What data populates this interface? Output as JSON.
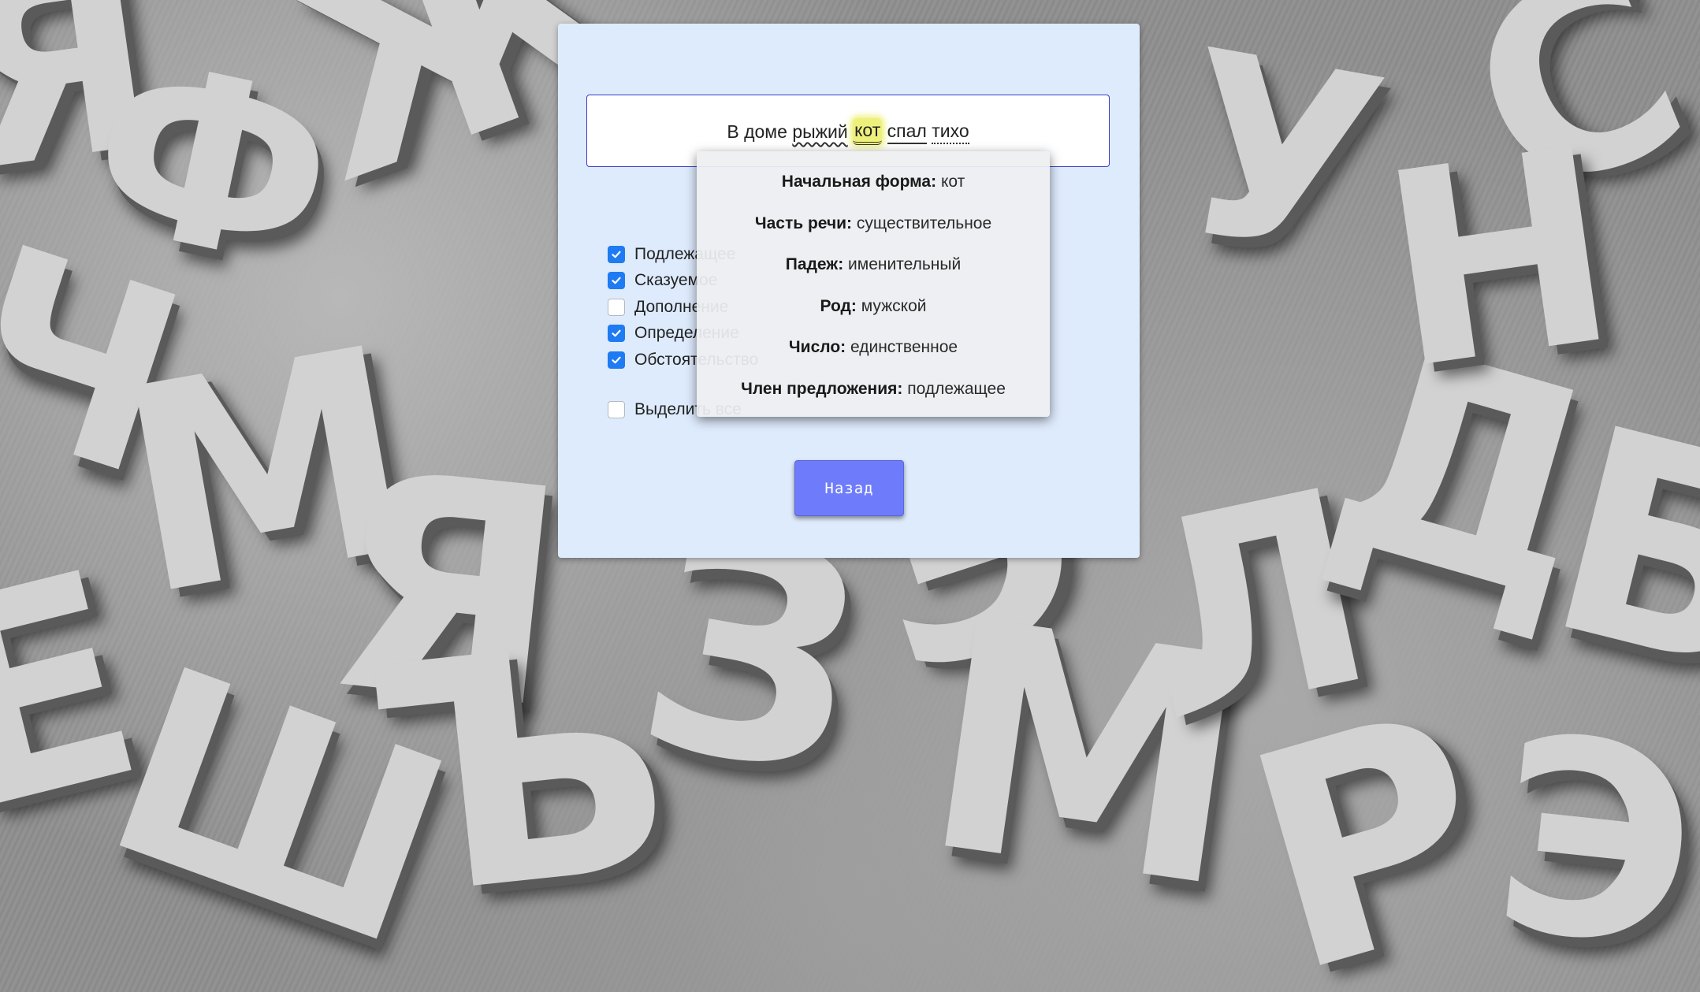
{
  "sentence": {
    "words": [
      {
        "text": "В",
        "style": "plain"
      },
      {
        "text": "доме",
        "style": "plain"
      },
      {
        "text": "рыжий",
        "style": "wavy"
      },
      {
        "text": "кот",
        "style": "double",
        "highlighted": true
      },
      {
        "text": "спал",
        "style": "solid"
      },
      {
        "text": "тихо",
        "style": "dotted"
      }
    ]
  },
  "checkboxes": [
    {
      "label": "Подлежащее",
      "checked": true
    },
    {
      "label": "Сказуемое",
      "checked": true
    },
    {
      "label": "Дополнение",
      "checked": false
    },
    {
      "label": "Определение",
      "checked": true
    },
    {
      "label": "Обстоятельство",
      "checked": true
    }
  ],
  "select_all": {
    "label": "Выделить все",
    "checked": false
  },
  "back_button": {
    "label": "Назад"
  },
  "tooltip": {
    "rows": [
      {
        "key": "Начальная форма:",
        "value": "кот"
      },
      {
        "key": "Часть речи:",
        "value": "существительное"
      },
      {
        "key": "Падеж:",
        "value": "именительный"
      },
      {
        "key": "Род:",
        "value": "мужской"
      },
      {
        "key": "Число:",
        "value": "единственное"
      },
      {
        "key": "Член предложения:",
        "value": "подлежащее"
      }
    ]
  },
  "colors": {
    "card_bg": "#deebfd",
    "checkbox_on": "#1f7bf2",
    "button_bg": "#6e7cfb",
    "highlight": "#eef07c",
    "input_border": "#3b3bc9"
  },
  "background_glyphs": [
    "Я",
    "Ф",
    "Ж",
    "Ч",
    "М",
    "Я",
    "Е",
    "Ш",
    "Ъ",
    "З",
    "Э",
    "М",
    "Л",
    "Д",
    "С",
    "У",
    "Н",
    "Б",
    "Р",
    "Э"
  ]
}
